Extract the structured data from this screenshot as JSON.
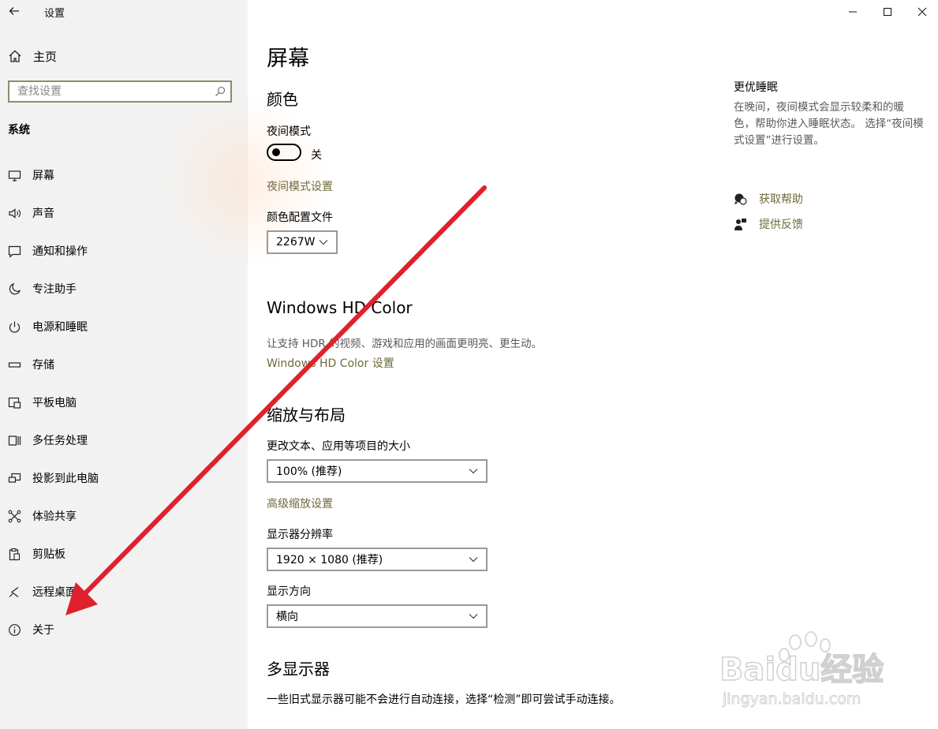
{
  "window": {
    "app_title": "设置",
    "back_icon": "back-arrow-icon",
    "minimize_icon": "minimize-icon",
    "maximize_icon": "maximize-icon",
    "close_icon": "close-icon"
  },
  "sidebar": {
    "home_label": "主页",
    "home_icon": "home-icon",
    "search_placeholder": "查找设置",
    "search_value": "",
    "section": "系统",
    "items": [
      {
        "label": "屏幕",
        "icon": "monitor-icon"
      },
      {
        "label": "声音",
        "icon": "speaker-icon"
      },
      {
        "label": "通知和操作",
        "icon": "notification-icon"
      },
      {
        "label": "专注助手",
        "icon": "moon-icon"
      },
      {
        "label": "电源和睡眠",
        "icon": "power-icon"
      },
      {
        "label": "存储",
        "icon": "storage-icon"
      },
      {
        "label": "平板电脑",
        "icon": "tablet-icon"
      },
      {
        "label": "多任务处理",
        "icon": "multitask-icon"
      },
      {
        "label": "投影到此电脑",
        "icon": "project-icon"
      },
      {
        "label": "体验共享",
        "icon": "share-icon"
      },
      {
        "label": "剪贴板",
        "icon": "clipboard-icon"
      },
      {
        "label": "远程桌面",
        "icon": "remote-desktop-icon"
      },
      {
        "label": "关于",
        "icon": "info-icon"
      }
    ]
  },
  "main": {
    "title": "屏幕",
    "color": {
      "heading": "颜色",
      "night_light_label": "夜间模式",
      "night_light_state": "关",
      "night_light_settings_link": "夜间模式设置",
      "color_profile_label": "颜色配置文件",
      "color_profile_value": "2267W"
    },
    "hdr": {
      "heading": "Windows HD Color",
      "description": "让支持 HDR 的视频、游戏和应用的画面更明亮、更生动。",
      "link": "Windows HD Color 设置"
    },
    "scale": {
      "heading": "缩放与布局",
      "size_label": "更改文本、应用等项目的大小",
      "size_value": "100% (推荐)",
      "advanced_link": "高级缩放设置",
      "resolution_label": "显示器分辨率",
      "resolution_value": "1920 × 1080 (推荐)",
      "orientation_label": "显示方向",
      "orientation_value": "横向"
    },
    "multi": {
      "heading": "多显示器",
      "description": "一些旧式显示器可能不会进行自动连接，选择“检测”即可尝试手动连接。"
    }
  },
  "right": {
    "title": "更优睡眠",
    "description": "在晚间，夜间模式会显示较柔和的暖色，帮助你进入睡眠状态。 选择“夜间模式设置”进行设置。",
    "help_label": "获取帮助",
    "help_icon": "get-help-icon",
    "feedback_label": "提供反馈",
    "feedback_icon": "feedback-icon"
  },
  "overlay": {
    "arrow_color": "#e0202c",
    "watermark_text": "Baidu经验",
    "watermark_url": "jingyan.baidu.com"
  },
  "colors": {
    "sidebar_bg": "#f2f2f2",
    "link": "#6e6a3a",
    "search_border": "#8d8d6b"
  }
}
